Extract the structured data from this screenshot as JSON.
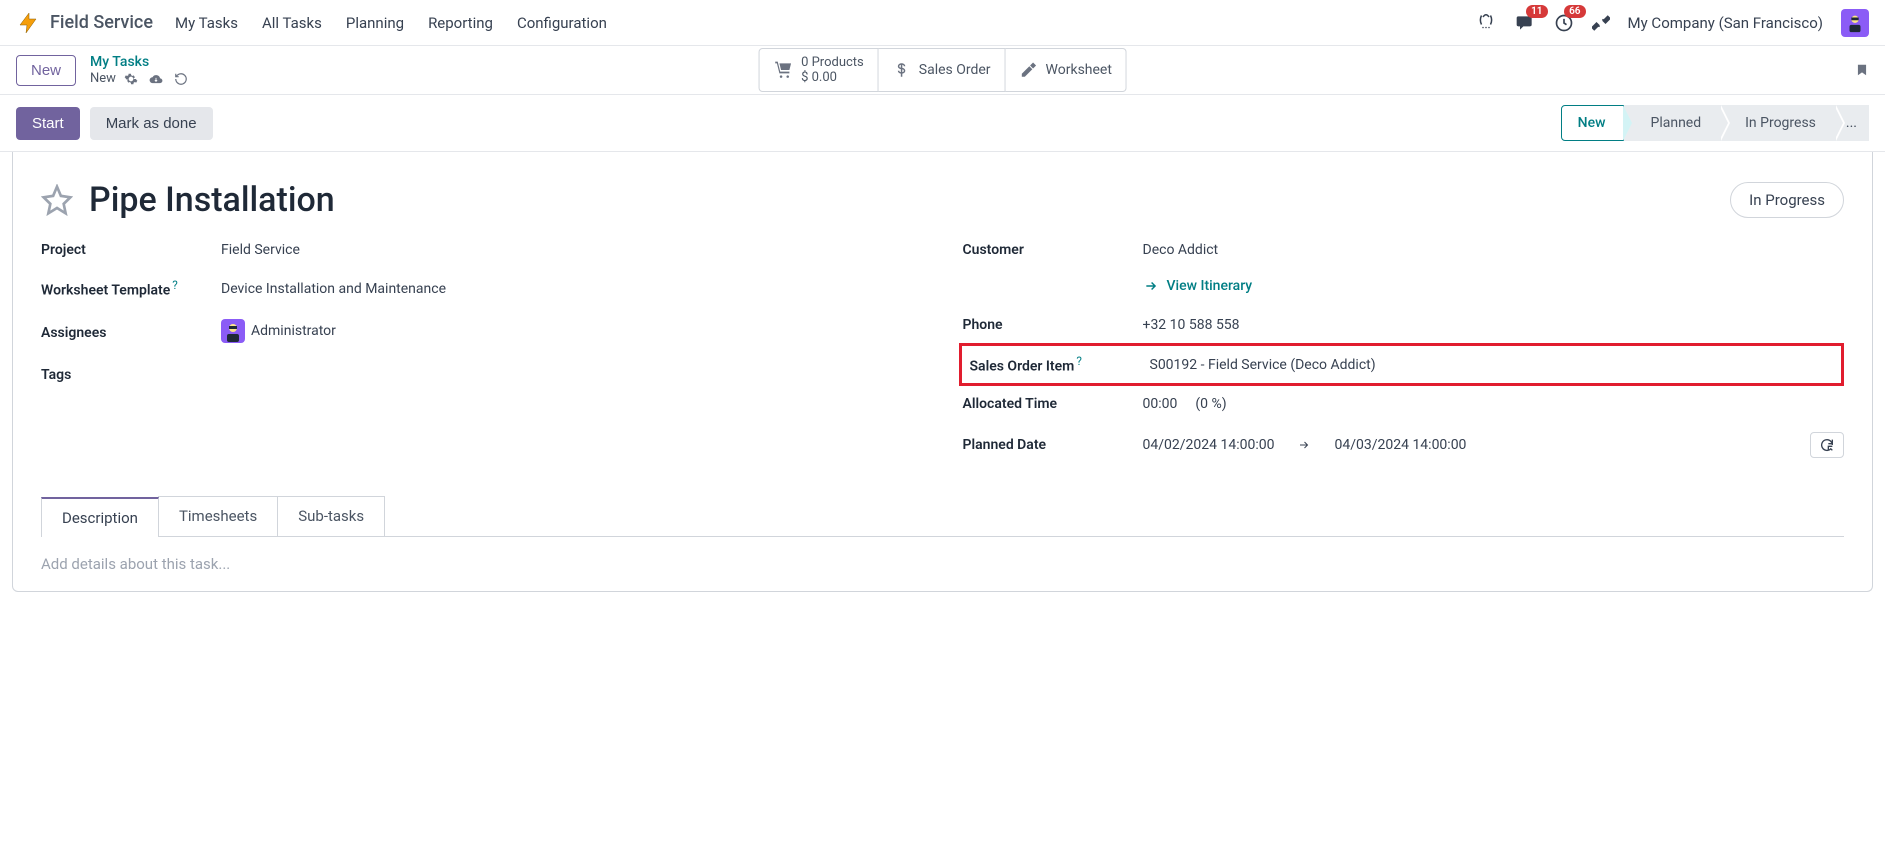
{
  "app": {
    "name": "Field Service"
  },
  "nav": {
    "items": [
      "My Tasks",
      "All Tasks",
      "Planning",
      "Reporting",
      "Configuration"
    ],
    "company": "My Company (San Francisco)",
    "chat_badge": "11",
    "activity_badge": "66"
  },
  "control_panel": {
    "new_button": "New",
    "breadcrumb_parent": "My Tasks",
    "breadcrumb_current": "New",
    "stats": {
      "products_line1": "0 Products",
      "products_line2": "$ 0.00",
      "sales_order": "Sales Order",
      "worksheet": "Worksheet"
    }
  },
  "status_bar": {
    "start": "Start",
    "mark_done": "Mark as done",
    "stages": [
      "New",
      "Planned",
      "In Progress"
    ],
    "more": "..."
  },
  "form": {
    "title": "Pipe Installation",
    "status_pill": "In Progress",
    "labels": {
      "project": "Project",
      "worksheet_template": "Worksheet Template",
      "assignees": "Assignees",
      "tags": "Tags",
      "customer": "Customer",
      "phone": "Phone",
      "sales_order_item": "Sales Order Item",
      "allocated_time": "Allocated Time",
      "planned_date": "Planned Date"
    },
    "values": {
      "project": "Field Service",
      "worksheet_template": "Device Installation and Maintenance",
      "assignee": "Administrator",
      "customer": "Deco Addict",
      "view_itinerary": "View Itinerary",
      "phone": "+32 10 588 558",
      "sales_order_item": "S00192 - Field Service (Deco Addict)",
      "allocated_time_hours": "00:00",
      "allocated_time_pct": "(0 %)",
      "planned_date_start": "04/02/2024 14:00:00",
      "planned_date_end": "04/03/2024 14:00:00"
    }
  },
  "tabs": {
    "items": [
      "Description",
      "Timesheets",
      "Sub-tasks"
    ],
    "description_placeholder": "Add details about this task..."
  }
}
